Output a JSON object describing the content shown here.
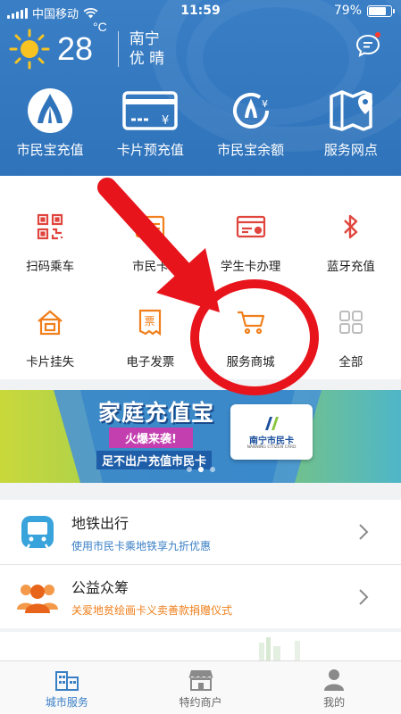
{
  "status_bar": {
    "carrier": "中国移动",
    "time": "11:59",
    "battery": "79%",
    "battery_level": 0.79
  },
  "weather": {
    "temperature": "28",
    "unit": "°C",
    "city": "南宁",
    "condition": "优 晴"
  },
  "quick_actions": [
    {
      "label": "市民宝充值",
      "icon": "citizen-recharge-icon"
    },
    {
      "label": "卡片预充值",
      "icon": "card-precharge-icon"
    },
    {
      "label": "市民宝余额",
      "icon": "balance-icon"
    },
    {
      "label": "服务网点",
      "icon": "map-location-icon"
    }
  ],
  "services": [
    {
      "label": "扫码乘车",
      "icon": "qr-code-icon"
    },
    {
      "label": "市民卡",
      "icon": "citizen-card-icon"
    },
    {
      "label": "学生卡办理",
      "icon": "student-card-icon"
    },
    {
      "label": "蓝牙充值",
      "icon": "bluetooth-icon"
    },
    {
      "label": "卡片挂失",
      "icon": "card-loss-icon"
    },
    {
      "label": "电子发票",
      "icon": "invoice-icon"
    },
    {
      "label": "服务商城",
      "icon": "shopping-cart-icon"
    },
    {
      "label": "全部",
      "icon": "all-grid-icon"
    }
  ],
  "banner": {
    "title": "家庭充值宝",
    "tag": "火爆来袭!",
    "subtitle": "足不出户充值市民卡",
    "card_name": "南宁市民卡",
    "card_en": "NANNING CITIZEN CARD",
    "active_slide": 1
  },
  "list": [
    {
      "title": "地铁出行",
      "subtitle": "使用市民卡乘地铁享九折优惠",
      "icon": "metro-icon",
      "subtitle_color": "#3a7fc6"
    },
    {
      "title": "公益众筹",
      "subtitle": "关爱地贫绘画卡义卖善款捐赠仪式",
      "icon": "people-group-icon",
      "subtitle_color": "#f07f1c"
    }
  ],
  "tabs": [
    {
      "label": "城市服务",
      "icon": "city-service-icon",
      "active": true
    },
    {
      "label": "特约商户",
      "icon": "store-icon",
      "active": false
    },
    {
      "label": "我的",
      "icon": "profile-icon",
      "active": false
    }
  ],
  "colors": {
    "header_blue": "#3a7fc6",
    "service_orange": "#f07f1c",
    "service_red": "#e0453d",
    "annotation_red": "#e8141c",
    "tab_active": "#3a7fc6"
  }
}
